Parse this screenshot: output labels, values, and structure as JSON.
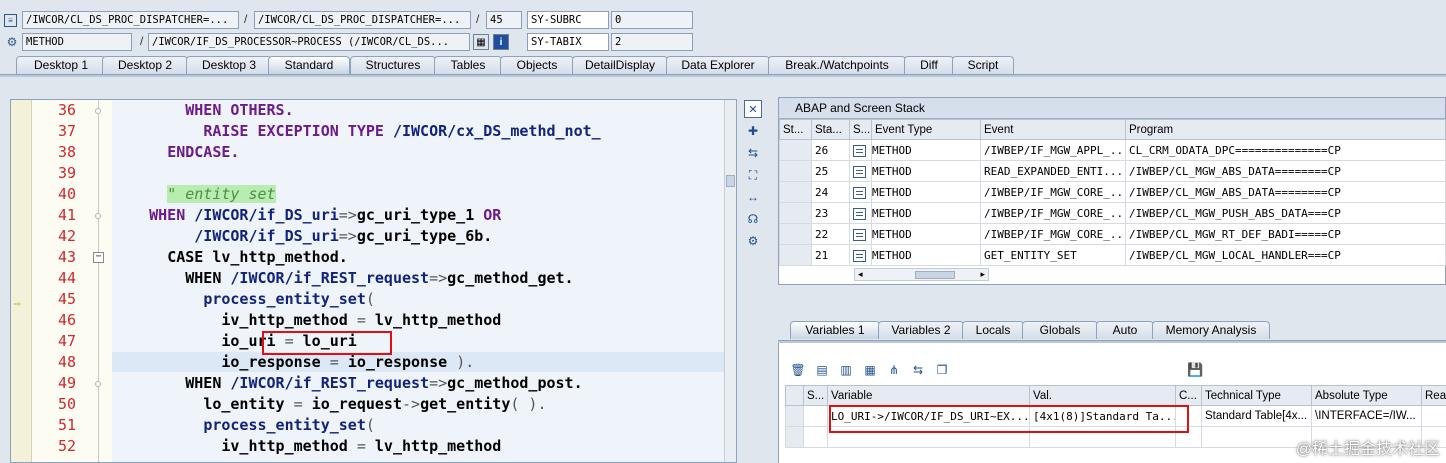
{
  "header": {
    "row1": {
      "program": "/IWCOR/CL_DS_PROC_DISPATCHER=...",
      "include": "/IWCOR/CL_DS_PROC_DISPATCHER=...",
      "line": "45",
      "sy_field": "SY-SUBRC",
      "sy_value": "0"
    },
    "row2": {
      "type": "METHOD",
      "name": "/IWCOR/IF_DS_PROCESSOR~PROCESS (/IWCOR/CL_DS...",
      "sy_field": "SY-TABIX",
      "sy_value": "2"
    },
    "separator": "/"
  },
  "tabs": [
    "Desktop 1",
    "Desktop 2",
    "Desktop 3",
    "Standard",
    "Structures",
    "Tables",
    "Objects",
    "DetailDisplay",
    "Data Explorer",
    "Break./Watchpoints",
    "Diff",
    "Script"
  ],
  "active_tab": "Standard",
  "code": {
    "lines": [
      {
        "no": "36",
        "parts": [
          {
            "t": "        "
          },
          {
            "t": "WHEN OTHERS.",
            "c": "kw"
          }
        ]
      },
      {
        "no": "37",
        "parts": [
          {
            "t": "          "
          },
          {
            "t": "RAISE EXCEPTION TYPE ",
            "c": "kw"
          },
          {
            "t": "/IWCOR/cx_DS_methd_not_",
            "c": "cls"
          }
        ]
      },
      {
        "no": "38",
        "parts": [
          {
            "t": "      "
          },
          {
            "t": "ENDCASE.",
            "c": "kw"
          }
        ]
      },
      {
        "no": "39",
        "parts": [
          {
            "t": ""
          }
        ]
      },
      {
        "no": "40",
        "parts": [
          {
            "t": "      "
          },
          {
            "t": "\" entity set",
            "c": "cmt"
          }
        ]
      },
      {
        "no": "41",
        "parts": [
          {
            "t": "    "
          },
          {
            "t": "WHEN ",
            "c": "kw"
          },
          {
            "t": "/IWCOR/if_DS_uri",
            "c": "cls"
          },
          {
            "t": "=>",
            "c": "op"
          },
          {
            "t": "gc_uri_type_1 ",
            "c": "kwb"
          },
          {
            "t": "OR",
            "c": "kw"
          }
        ]
      },
      {
        "no": "42",
        "parts": [
          {
            "t": "         "
          },
          {
            "t": "/IWCOR/if_DS_uri",
            "c": "cls"
          },
          {
            "t": "=>",
            "c": "op"
          },
          {
            "t": "gc_uri_type_6b.",
            "c": "kwb"
          }
        ]
      },
      {
        "no": "43",
        "parts": [
          {
            "t": "      "
          },
          {
            "t": "CASE ",
            "c": "kwb"
          },
          {
            "t": "lv_http_method.",
            "c": "kwb"
          }
        ]
      },
      {
        "no": "44",
        "parts": [
          {
            "t": "        "
          },
          {
            "t": "WHEN ",
            "c": "kwb"
          },
          {
            "t": "/IWCOR/if_REST_request",
            "c": "cls"
          },
          {
            "t": "=>",
            "c": "op"
          },
          {
            "t": "gc_method_get.",
            "c": "kwb"
          }
        ]
      },
      {
        "no": "45",
        "parts": [
          {
            "t": "          "
          },
          {
            "t": "process_entity_set",
            "c": "cls"
          },
          {
            "t": "(",
            "c": "op"
          }
        ]
      },
      {
        "no": "46",
        "parts": [
          {
            "t": "            "
          },
          {
            "t": "iv_http_method ",
            "c": "kwb"
          },
          {
            "t": "= ",
            "c": "op"
          },
          {
            "t": "lv_http_method",
            "c": "kwb"
          }
        ]
      },
      {
        "no": "47",
        "parts": [
          {
            "t": "            "
          },
          {
            "t": "io_uri ",
            "c": "kwb"
          },
          {
            "t": "= ",
            "c": "op"
          },
          {
            "t": "lo_uri",
            "c": "kwb"
          }
        ]
      },
      {
        "no": "48",
        "parts": [
          {
            "t": "            "
          },
          {
            "t": "io_response ",
            "c": "kwb"
          },
          {
            "t": "= ",
            "c": "op"
          },
          {
            "t": "io_response ",
            "c": "kwb"
          },
          {
            "t": ").",
            "c": "op"
          }
        ]
      },
      {
        "no": "49",
        "parts": [
          {
            "t": "        "
          },
          {
            "t": "WHEN ",
            "c": "kwb"
          },
          {
            "t": "/IWCOR/if_REST_request",
            "c": "cls"
          },
          {
            "t": "=>",
            "c": "op"
          },
          {
            "t": "gc_method_post.",
            "c": "kwb"
          }
        ]
      },
      {
        "no": "50",
        "parts": [
          {
            "t": "          "
          },
          {
            "t": "lo_entity ",
            "c": "kwb"
          },
          {
            "t": "= ",
            "c": "op"
          },
          {
            "t": "io_request",
            "c": "kwb"
          },
          {
            "t": "->",
            "c": "op"
          },
          {
            "t": "get_entity",
            "c": "kwb"
          },
          {
            "t": "( ).",
            "c": "op"
          }
        ]
      },
      {
        "no": "51",
        "parts": [
          {
            "t": "          "
          },
          {
            "t": "process_entity_set",
            "c": "cls"
          },
          {
            "t": "(",
            "c": "op"
          }
        ]
      },
      {
        "no": "52",
        "parts": [
          {
            "t": "            "
          },
          {
            "t": "iv_http_method ",
            "c": "kwb"
          },
          {
            "t": "= ",
            "c": "op"
          },
          {
            "t": "lv_http_method",
            "c": "kwb"
          }
        ]
      }
    ]
  },
  "stack": {
    "title": "ABAP and Screen Stack",
    "columns": [
      "St...",
      "Sta...",
      "S...",
      "Event Type",
      "Event",
      "Program"
    ],
    "rows": [
      {
        "level": "26",
        "type": "METHOD",
        "event": "/IWBEP/IF_MGW_APPL_...",
        "program": "CL_CRM_ODATA_DPC==============CP"
      },
      {
        "level": "25",
        "type": "METHOD",
        "event": "READ_EXPANDED_ENTI...",
        "program": "/IWBEP/CL_MGW_ABS_DATA========CP"
      },
      {
        "level": "24",
        "type": "METHOD",
        "event": "/IWBEP/IF_MGW_CORE_...",
        "program": "/IWBEP/CL_MGW_ABS_DATA========CP"
      },
      {
        "level": "23",
        "type": "METHOD",
        "event": "/IWBEP/IF_MGW_CORE_...",
        "program": "/IWBEP/CL_MGW_PUSH_ABS_DATA===CP"
      },
      {
        "level": "22",
        "type": "METHOD",
        "event": "/IWBEP/IF_MGW_CORE_...",
        "program": "/IWBEP/CL_MGW_RT_DEF_BADI=====CP"
      },
      {
        "level": "21",
        "type": "METHOD",
        "event": "GET_ENTITY_SET",
        "program": "/IWBEP/CL_MGW_LOCAL_HANDLER===CP"
      }
    ]
  },
  "var_tabs": [
    "Variables 1",
    "Variables 2",
    "Locals",
    "Globals",
    "Auto",
    "Memory Analysis"
  ],
  "active_var_tab": "Variables 1",
  "variables": {
    "columns": [
      "S...",
      "Variable",
      "Val.",
      "C...",
      "Technical Type",
      "Absolute Type",
      "Rea"
    ],
    "rows": [
      {
        "variable": "LO_URI->/IWCOR/IF_DS_URI~EX...",
        "value": "[4x1(8)]Standard Ta...",
        "technical_type": "Standard Table[4x...",
        "absolute_type": "\\INTERFACE=/IW..."
      }
    ]
  },
  "watermark": "@稀土掘金技术社区",
  "colors": {
    "accent_red": "#e01010",
    "line_number": "#d4262c",
    "keyword": "#6d1a8a",
    "comment_bg": "#b8ecb0"
  }
}
